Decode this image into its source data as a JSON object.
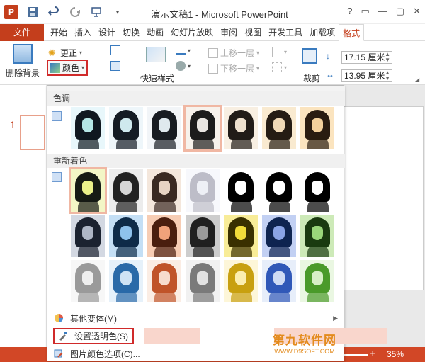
{
  "window": {
    "title": "演示文稿1 - Microsoft PowerPoint",
    "controls": [
      "?",
      "▭",
      "—",
      "▢",
      "✕"
    ]
  },
  "tabs": [
    "文件",
    "开始",
    "插入",
    "设计",
    "切换",
    "动画",
    "幻灯片放映",
    "审阅",
    "视图",
    "开发工具",
    "加载项",
    "格式"
  ],
  "active_tab": "格式",
  "ribbon": {
    "remove_bg_label": "删除背景",
    "corrections_label": "更正",
    "color_label": "颜色",
    "quick_styles_label": "快速样式",
    "bring_forward_label": "上移一层",
    "send_backward_label": "下移一层",
    "crop_label": "裁剪",
    "height_value": "17.15 厘米",
    "width_value": "13.95 厘米"
  },
  "slides_pane": {
    "slide_number": "1"
  },
  "dropdown": {
    "section_saturation": "色调",
    "section_recolor": "重新着色",
    "more_variations": "其他变体(M)",
    "set_transparent": "设置透明色(S)",
    "picture_color_options": "图片颜色选项(C)..."
  },
  "swatches": {
    "tone_row": [
      {
        "hair": "#101820",
        "face": "#b6e7e6",
        "bg": "#e8f7fb"
      },
      {
        "hair": "#141b24",
        "face": "#cfe9ee",
        "bg": "#eef6fa"
      },
      {
        "hair": "#181c22",
        "face": "#dfe9ee",
        "bg": "#f2f5f8"
      },
      {
        "hair": "#1c1c1c",
        "face": "#e9e6e2",
        "bg": "#f7f2ec"
      },
      {
        "hair": "#211c18",
        "face": "#eee1cf",
        "bg": "#f8efe2"
      },
      {
        "hair": "#251c14",
        "face": "#f1dab8",
        "bg": "#f9ead0"
      },
      {
        "hair": "#2a1c10",
        "face": "#f4d19c",
        "bg": "#fbe4bf"
      }
    ],
    "recolor_row1": [
      {
        "hair": "#161a14",
        "face": "#eaf08a",
        "bg": "#f3f6c6"
      },
      {
        "hair": "#222222",
        "face": "#d6d6d6",
        "bg": "#ececec"
      },
      {
        "hair": "#3a2a22",
        "face": "#e8d4c4",
        "bg": "#f4e7dc"
      },
      {
        "hair": "#bdbdc8",
        "face": "#eef0f6",
        "bg": "#f7f8fc"
      },
      {
        "hair": "#000000",
        "face": "#ffffff",
        "bg": "#ffffff"
      },
      {
        "hair": "#000000",
        "face": "#ffffff",
        "bg": "#ffffff"
      },
      {
        "hair": "#000000",
        "face": "#ffffff",
        "bg": "#ffffff"
      }
    ],
    "recolor_row2": [
      {
        "hair": "#1b2230",
        "face": "#aeb6c6",
        "bg": "#d3d8e2"
      },
      {
        "hair": "#0e2b48",
        "face": "#8ec2ec",
        "bg": "#c4dff5"
      },
      {
        "hair": "#4a1e0e",
        "face": "#f0a27a",
        "bg": "#f7cdb4"
      },
      {
        "hair": "#202020",
        "face": "#9a9a9a",
        "bg": "#cdcdcd"
      },
      {
        "hair": "#3a3000",
        "face": "#f2dc3a",
        "bg": "#f8ec98"
      },
      {
        "hair": "#0e2450",
        "face": "#8aa4e6",
        "bg": "#c2d0f3"
      },
      {
        "hair": "#1a3a10",
        "face": "#9ad67a",
        "bg": "#cdeab8"
      }
    ],
    "recolor_row3": [
      {
        "hair": "#9a9a9a",
        "face": "#efefef",
        "bg": "#f7f7f7"
      },
      {
        "hair": "#2a6aa8",
        "face": "#cfe3f5",
        "bg": "#e6f1fa"
      },
      {
        "hair": "#c0542a",
        "face": "#f7dccd",
        "bg": "#fbede4"
      },
      {
        "hair": "#7a7a7a",
        "face": "#e2e2e2",
        "bg": "#f1f1f1"
      },
      {
        "hair": "#c8a010",
        "face": "#fbeeb0",
        "bg": "#fdf6d8"
      },
      {
        "hair": "#3058b8",
        "face": "#cfdbf4",
        "bg": "#e7eefa"
      },
      {
        "hair": "#4a9a2a",
        "face": "#d6efc6",
        "bg": "#eaf7e2"
      }
    ]
  },
  "status": {
    "zoom": "35%",
    "plus": "+"
  },
  "watermark": {
    "line1": "第九软件网",
    "line2": "WWW.D9SOFT.COM"
  }
}
